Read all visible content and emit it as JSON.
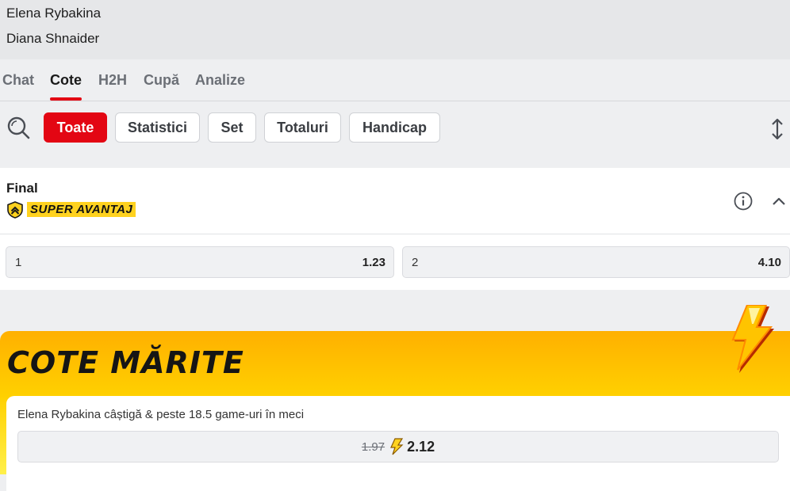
{
  "header": {
    "player1": "Elena Rybakina",
    "player2": "Diana Shnaider"
  },
  "tabs": [
    {
      "label": "Chat"
    },
    {
      "label": "Cote"
    },
    {
      "label": "H2H"
    },
    {
      "label": "Cupă"
    },
    {
      "label": "Analize"
    }
  ],
  "active_tab": "Cote",
  "filters": [
    {
      "label": "Toate"
    },
    {
      "label": "Statistici"
    },
    {
      "label": "Set"
    },
    {
      "label": "Totaluri"
    },
    {
      "label": "Handicap"
    }
  ],
  "active_filter": "Toate",
  "market": {
    "title": "Final",
    "badge": "SUPER AVANTAJ",
    "odds": [
      {
        "label": "1",
        "value": "1.23"
      },
      {
        "label": "2",
        "value": "4.10"
      }
    ]
  },
  "promo": {
    "title": "COTE MĂRITE",
    "description": "Elena Rybakina câștigă & peste 18.5 game-uri în meci",
    "old_odd": "1.97",
    "new_odd": "2.12"
  },
  "colors": {
    "accent": "#e30613",
    "badge": "#ffd21f",
    "promo_top": "#ffb000",
    "promo_bottom": "#fff04a"
  }
}
